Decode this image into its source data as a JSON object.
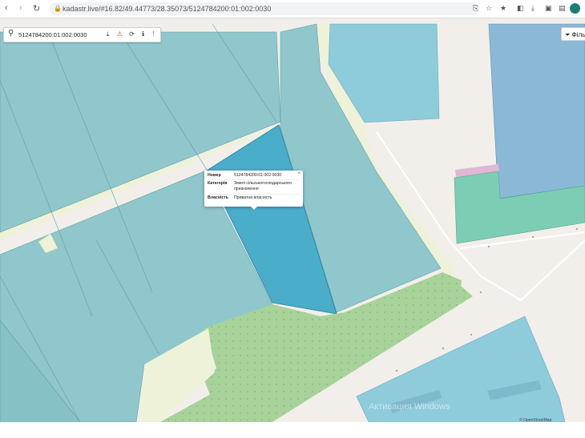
{
  "browser": {
    "url": "kadastr.live/#16.82/49.44773/28.35073/5124784200:01:002:0030",
    "back_glyph": "‹",
    "forward_glyph": "›",
    "reload_glyph": "↻"
  },
  "search": {
    "value": "5124784200:01:002:0030",
    "icon": "search-icon"
  },
  "toolbar": {
    "download_glyph": "⤓",
    "warning_glyph": "⚠",
    "refresh_glyph": "⟳",
    "info_glyph": "ℹ",
    "report_glyph": "!"
  },
  "filter": {
    "label": "Фільтр",
    "icon": "filter-icon"
  },
  "popup": {
    "close_glyph": "×",
    "rows": [
      {
        "key": "Номер",
        "value": "5124784200:01:002:0030"
      },
      {
        "key": "Категорія",
        "value": "Землі сільськогосподарського призначення"
      },
      {
        "key": "Власність",
        "value": "Приватна власність"
      }
    ]
  },
  "colors": {
    "parcel": "#8fc7cc",
    "parcel_selected": "#4aaecb",
    "road": "#eef2d8",
    "forest": "#a7d39b",
    "building_blue": "#8ab8d6",
    "commercial": "#7ccdb4",
    "background": "#f2efea"
  },
  "watermark": "Активация Windows",
  "attribution": "© OpenStreetMap"
}
